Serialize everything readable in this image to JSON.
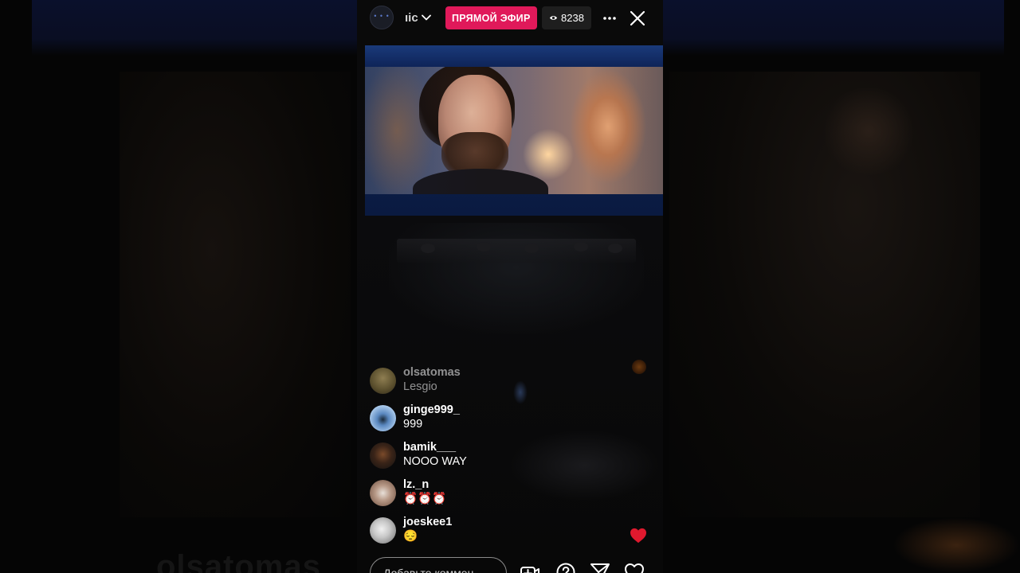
{
  "header": {
    "host_name": "ıic",
    "live_label": "ПРЯМОЙ ЭФИР",
    "viewer_count": "8238"
  },
  "backdrop": {
    "ghost_text": "olsatomas"
  },
  "comments": [
    {
      "user": "olsatomas",
      "text": "Lesgio"
    },
    {
      "user": "ginge999_",
      "text": "999"
    },
    {
      "user": "bamik___",
      "text": "NOOO WAY"
    },
    {
      "user": "lz._n",
      "text": "⏰⏰⏰"
    },
    {
      "user": "joeskee1",
      "text": "😔"
    }
  ],
  "comment_input": {
    "placeholder": "Добавьте коммен..."
  },
  "colors": {
    "live_badge": "#e0195a",
    "heart": "#e0192e"
  }
}
